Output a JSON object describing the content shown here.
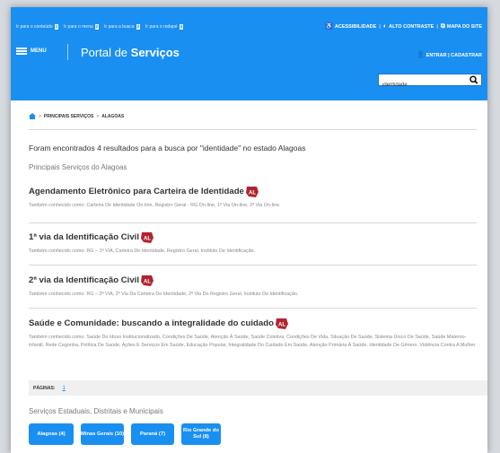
{
  "header": {
    "skip_links": [
      {
        "label": "Ir para o conteúdo",
        "key": "1"
      },
      {
        "label": "Ir para o menu",
        "key": "2"
      },
      {
        "label": "Ir para a busca",
        "key": "3"
      },
      {
        "label": "Ir para o rodapé",
        "key": "4"
      }
    ],
    "accessibility": "ACESSIBILIDADE",
    "high_contrast": "ALTO CONTRASTE",
    "sitemap": "MAPA DO SITE",
    "menu_label": "MENU",
    "portal_title_prefix": "Portal de ",
    "portal_title_bold": "Serviços",
    "login_label": "ENTRAR | CADASTRAR",
    "search_value": "identidade"
  },
  "breadcrumb": {
    "items": [
      "PRINCIPAIS SERVIÇOS",
      "ALAGOAS"
    ],
    "separator": ">"
  },
  "summary": "Foram encontrados 4 resultados para a busca por \"identidade\" no estado Alagoas",
  "section_title": "Principais Serviços do Alagoas",
  "badge_text": "AL",
  "results": [
    {
      "title": "Agendamento Eletrônico para Carteira de Identidade",
      "description": "Também conhecido como: Carteira De Identidade On-line, Registro Geral - RG On-line, 1ª Via On-line, 2ª Via On-line."
    },
    {
      "title": "1ª via da Identificação Civil",
      "description": "Também conhecido como: RG – 1ª VIA, Carteira De Identidade, Registro Geral, Instituto De Identificação."
    },
    {
      "title": "2ª via da Identificação Civil",
      "description": "Também conhecido como: RG – 2ª VIA, 2ª Via Da Carteira De Identidade, 2ª Via Do Registro Geral, Instituto De Identificação."
    },
    {
      "title": "Saúde e Comunidade: buscando a integralidade do cuidado",
      "description": "Também conhecido como: Saúde Do Idoso Institucionalizado, Condições De Saúde, Atenção À Saúde, Saúde Coletiva, Condições De Vida, Situação De Saúde, Sistema Único De Saúde, Saúde Materno-infantil, Rede Cegonha, Política De Saúde, Ações E Serviços Em Saúde, Educação Popular, Integralidade Do Cuidado Em Saúde, Atenção Primária À Saúde, Identidade De Gênero, Violência Contra A Mulher."
    }
  ],
  "pagination": {
    "label": "PÁGINAS:",
    "pages": [
      "1"
    ]
  },
  "state_section_title": "Serviços Estaduais, Distritais e Municipais",
  "state_buttons": [
    {
      "label": "Alagoas (4)"
    },
    {
      "label": "Minas Gerais (10)"
    },
    {
      "label": "Paraná (7)"
    },
    {
      "label": "Rio Grande do Sul (8)"
    }
  ],
  "colors": {
    "header_blue": "#1a8ff2",
    "badge_red": "#b2232f",
    "text_dark": "#333333",
    "text_muted": "#888888"
  },
  "icons": [
    "accessibility-icon",
    "contrast-icon",
    "sitemap-icon",
    "user-icon",
    "search-icon",
    "home-icon",
    "hamburger-icon"
  ]
}
